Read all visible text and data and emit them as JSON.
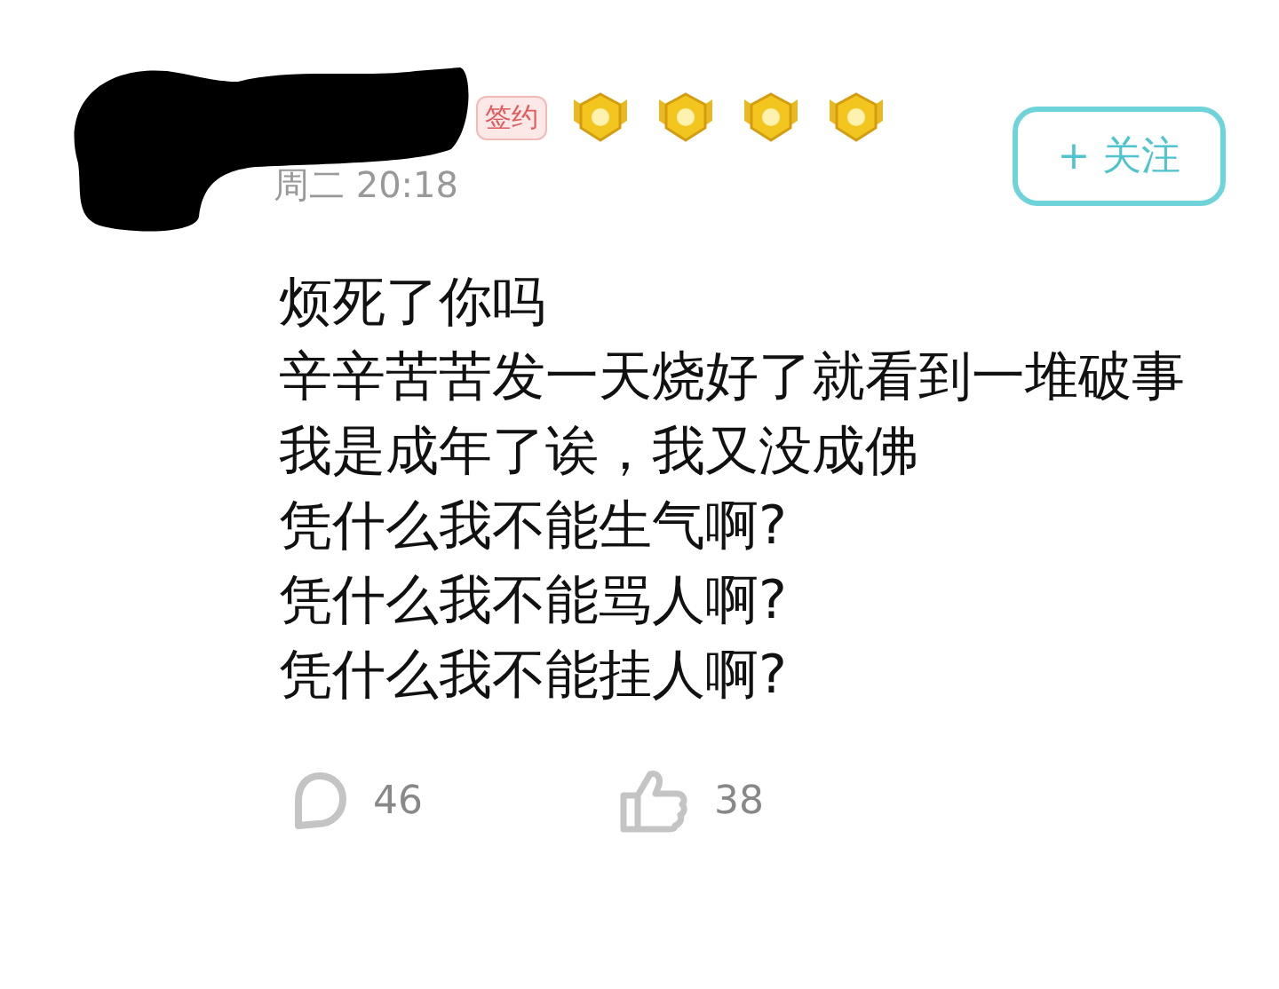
{
  "post": {
    "tag": "签约",
    "time": "周二 20:18",
    "follow_button": "+ 关注",
    "lines": [
      "烦死了你吗",
      "辛辛苦苦发一天烧好了就看到一堆破事",
      "我是成年了诶，我又没成佛",
      "凭什么我不能生气啊?",
      "凭什么我不能骂人啊?",
      "凭什么我不能挂人啊?"
    ],
    "comments": "46",
    "likes": "38"
  }
}
